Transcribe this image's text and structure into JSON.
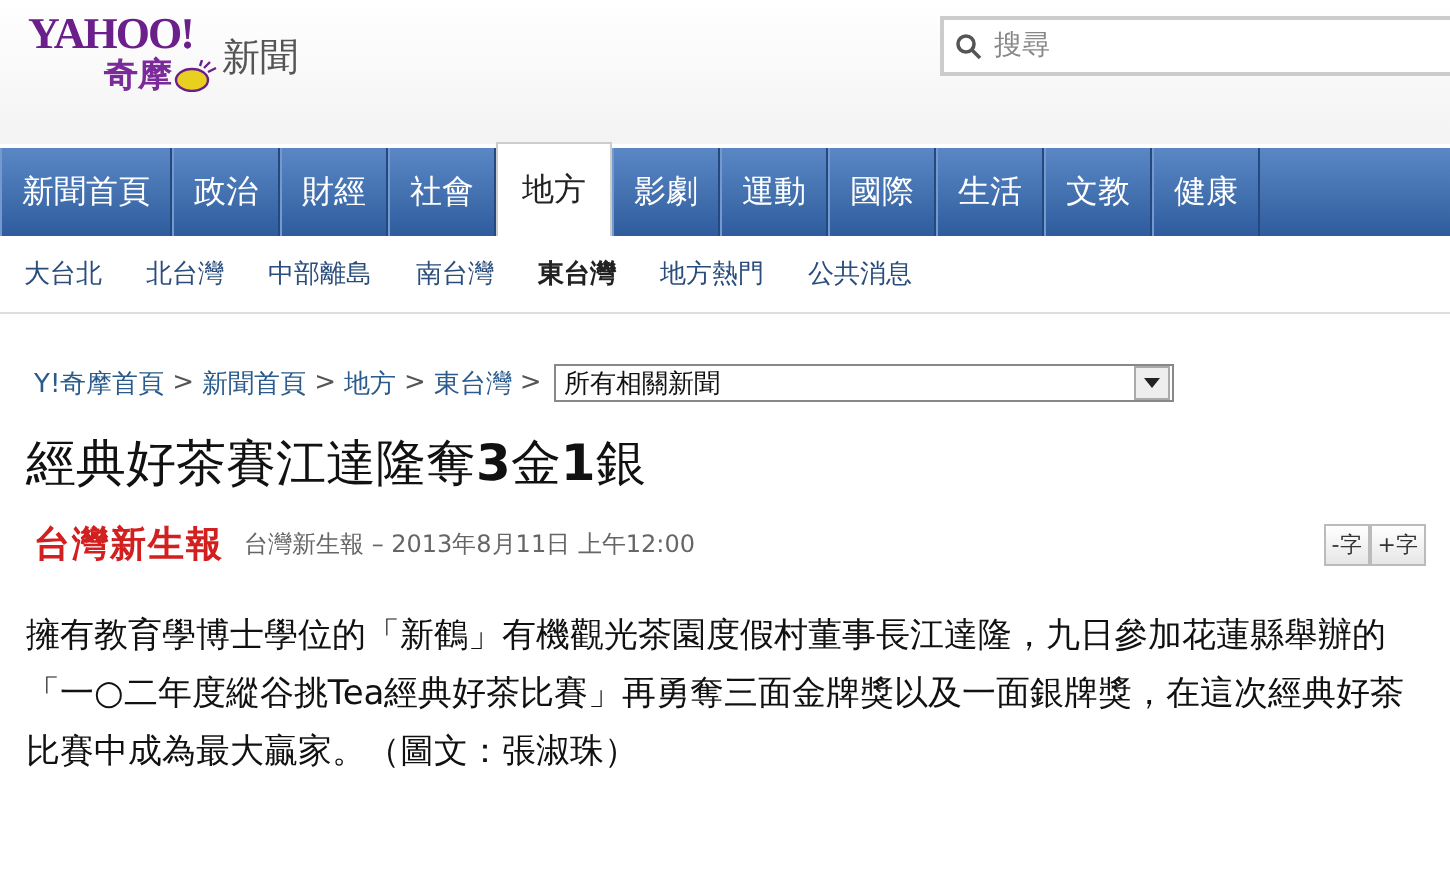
{
  "header": {
    "logo_top": "YAHOO!",
    "logo_bottom": "奇摩",
    "section": "新聞",
    "search": {
      "placeholder": "搜尋"
    }
  },
  "nav": [
    {
      "label": "新聞首頁",
      "selected": false
    },
    {
      "label": "政治",
      "selected": false
    },
    {
      "label": "財經",
      "selected": false
    },
    {
      "label": "社會",
      "selected": false
    },
    {
      "label": "地方",
      "selected": true
    },
    {
      "label": "影劇",
      "selected": false
    },
    {
      "label": "運動",
      "selected": false
    },
    {
      "label": "國際",
      "selected": false
    },
    {
      "label": "生活",
      "selected": false
    },
    {
      "label": "文教",
      "selected": false
    },
    {
      "label": "健康",
      "selected": false
    }
  ],
  "subnav": [
    {
      "label": "大台北",
      "selected": false
    },
    {
      "label": "北台灣",
      "selected": false
    },
    {
      "label": "中部離島",
      "selected": false
    },
    {
      "label": "南台灣",
      "selected": false
    },
    {
      "label": "東台灣",
      "selected": true
    },
    {
      "label": "地方熱門",
      "selected": false
    },
    {
      "label": "公共消息",
      "selected": false
    }
  ],
  "breadcrumb": [
    "Y!奇摩首頁",
    "新聞首頁",
    "地方",
    "東台灣"
  ],
  "breadcrumb_separator": ">",
  "related_select": "所有相關新聞",
  "article": {
    "title": "經典好茶賽江達隆奪**3**金**1**銀",
    "source_logo": "台灣新生報",
    "byline": "台灣新生報 – 2013年8月11日 上午12:00",
    "font_buttons": [
      "-字",
      "+字"
    ],
    "body": "擁有教育學博士學位的「新鶴」有機觀光茶園度假村董事長江達隆，九日參加花蓮縣舉辦的「一○二年度縱谷挑Tea經典好茶比賽」再勇奪三面金牌獎以及一面銀牌獎，在這次經典好茶比賽中成為最大贏家。（圖文：張淑珠）"
  }
}
